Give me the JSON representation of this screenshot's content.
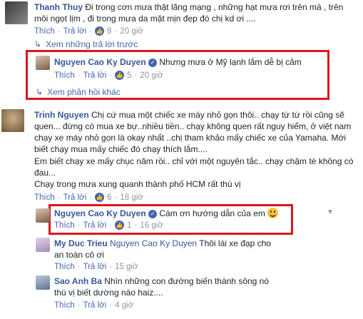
{
  "labels": {
    "like": "Thích",
    "reply": "Trả lời",
    "dot": "·"
  },
  "c1": {
    "name": "Thanh Thuy",
    "text": "Đi trong cơn mưa thật lãng mạng , những hạt mưa rơi trên má , trên môi ngọt lịm , đi trong mưa da mặt mịn đẹp đó chị kd ơi ....",
    "likes": "8",
    "time": "20 giờ",
    "more_prev": "Xem những trả lời trước"
  },
  "r1": {
    "name": "Nguyen Cao Ky Duyen",
    "text": "Nhưng mưa ở Mỹ lạnh lắm dễ bị cảm",
    "likes": "5",
    "time": "20 giờ",
    "more_other": "Xem phản hồi khác"
  },
  "c2": {
    "name": "Trinh Nguyen",
    "text": "Chị cứ mua một chiếc xe máy nhỏ gọn thôi.. chạy từ từ rồi cũng sẽ quen... đừng có mua xe bự..nhiều tiền.. chạy không quen rất nguy hiểm, ở việt nam chạy xe máy nhỏ gọn là okay nhất ..chị tham khảo mấy chiếc xe của Yamaha. Mới biết chạy mua mấy chiếc đó chạy thích lắm....",
    "text2": "Em biết chạy xe mấy chục năm rồi.. chỉ với một nguyên tắc.. chạy chậm tè không có đau...",
    "text3": "Chạy trong mưa xung quanh thành phố HCM rất thú vị",
    "likes": "6",
    "time": "18 giờ"
  },
  "r2": {
    "name": "Nguyen Cao Ky Duyen",
    "text": "Cám ơn hướng dẫn của em",
    "likes": "1",
    "time": "16 giờ"
  },
  "r3": {
    "name": "My Duc Trieu",
    "tag": "Nguyen Cao Ky Duyen",
    "text": "Thôi lái xe đạp cho an toàn cô ơi",
    "time": "15 giờ"
  },
  "r4": {
    "name": "Sao Anh Ba",
    "text": "Nhìn những con đường biến thành sông nó thú vị biết dường nào haiz....",
    "time": "4 giờ"
  },
  "colors": {
    "accent": "#4267b2",
    "name": "#365899",
    "highlight_box": "#e0141e"
  }
}
